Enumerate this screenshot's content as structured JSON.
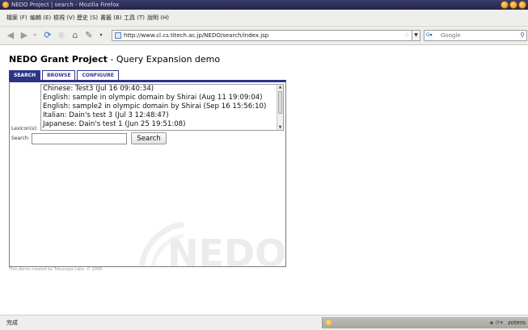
{
  "window": {
    "title": "NEDO Project | search - Mozilla Firefox"
  },
  "menu": {
    "items": [
      "檔案 (F)",
      "編輯 (E)",
      "檢視 (V)",
      "歷史 (S)",
      "書籤 (B)",
      "工具 (T)",
      "說明 (H)"
    ]
  },
  "toolbar": {
    "url": "http://www.cl.cs.titech.ac.jp/NEDO/search/index.jsp",
    "search_engine": "G",
    "search_placeholder": "Google"
  },
  "page": {
    "title_bold": "NEDO Grant Project",
    "title_rest": " - Query Expansion demo",
    "tabs": [
      "SEARCH",
      "BROWSE",
      "CONFIGURE"
    ],
    "lexicon_label": "Lexicon(s):",
    "lexicons": [
      "Chinese: Test3 (Jul 16 09:40:34)",
      "English: sample in olympic domain by Shirai (Aug 11 19:09:04)",
      "English: sample2 in olympic domain by Shirai (Sep 16 15:56:10)",
      "Italian: Dain's test 3 (Jul 3 12:48:47)",
      "Japanese: Dain's test 1 (Jun 25 19:51:08)"
    ],
    "search_label": "Search:",
    "search_button": "Search",
    "watermark": "NEDO",
    "footer": "This demo created by Tokunaga Labs. © 2008."
  },
  "status": {
    "text": "完成",
    "zotero": "zotero"
  }
}
